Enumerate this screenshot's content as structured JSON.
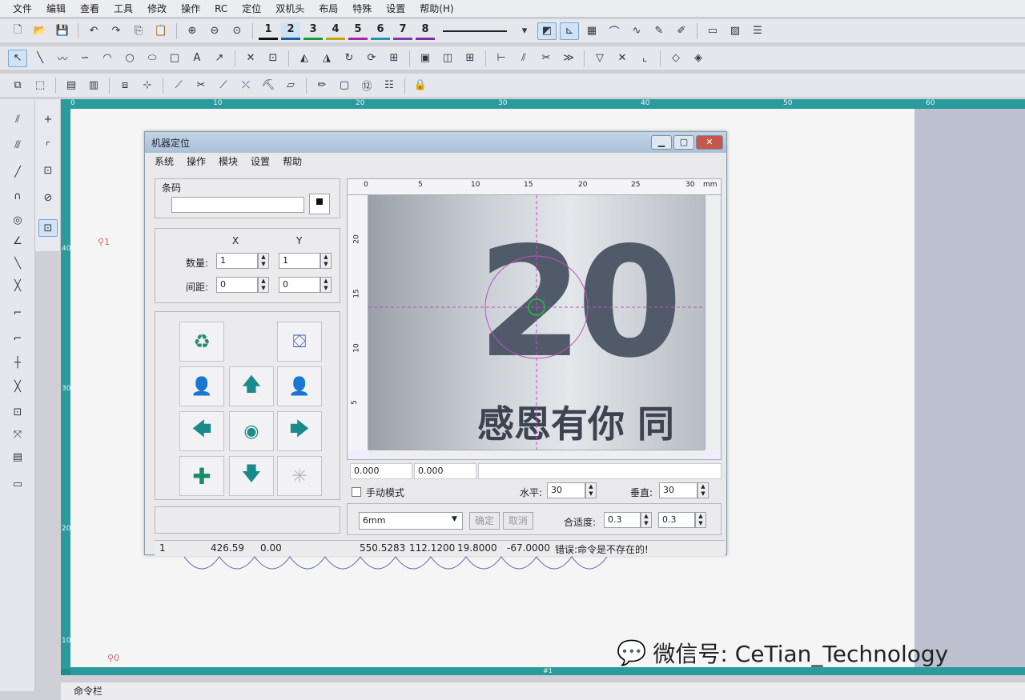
{
  "menu": [
    "文件",
    "编辑",
    "查看",
    "工具",
    "修改",
    "操作",
    "RC",
    "定位",
    "双机头",
    "布局",
    "特殊",
    "设置",
    "帮助(H)"
  ],
  "colors": {
    "c1": "#111111",
    "c2": "#1d5aa8",
    "c3": "#1b9a3a",
    "c4": "#b6a900",
    "c5": "#a224a8",
    "c6": "#1a9aa8",
    "c7": "#7a3aa8",
    "c8": "#7b2aa8"
  },
  "toolbar1": {
    "color_nums": [
      "1",
      "2",
      "3",
      "4",
      "5",
      "6",
      "7",
      "8"
    ]
  },
  "ruler": {
    "h_ticks": [
      "0",
      "10",
      "20",
      "30",
      "40",
      "50",
      "60"
    ],
    "v_ticks": [
      "40",
      "30",
      "20",
      "10"
    ]
  },
  "canvas": {
    "marker1": "1",
    "marker0": "0",
    "bottom_label": "#1"
  },
  "cmdbar": {
    "label": "命令栏"
  },
  "dialog": {
    "title": "机器定位",
    "title_buttons": [
      "▁",
      "▢",
      "✕"
    ],
    "menu": [
      "系统",
      "操作",
      "模块",
      "设置",
      "帮助"
    ],
    "barcode": {
      "label": "条码",
      "value": ""
    },
    "grid": {
      "col_x": "X",
      "col_y": "Y",
      "count_label": "数量:",
      "spacing_label": "间距:",
      "count_x": "1",
      "count_y": "1",
      "spacing_x": "0",
      "spacing_y": "0"
    },
    "camera": {
      "unit": "mm",
      "top_ticks": [
        "0",
        "5",
        "10",
        "15",
        "20",
        "25",
        "30"
      ],
      "left_ticks": [
        "20",
        "15",
        "10",
        "5"
      ],
      "big_text": "20",
      "slogan": "感恩有你 同",
      "coord_x": "0.000",
      "coord_y": "0.000"
    },
    "manual_mode": "手动模式",
    "horizontal": {
      "label": "水平:",
      "value": "30"
    },
    "vertical": {
      "label": "垂直:",
      "value": "30"
    },
    "size_select": "6mm",
    "confirm": "确定",
    "cancel": "取消",
    "fit": {
      "label": "合适度:",
      "value1": "0.3",
      "value2": "0.3"
    },
    "status": {
      "s1": "1",
      "s2": "426.59",
      "s3": "0.00",
      "s4": "550.5283",
      "s5": "112.1200",
      "s6": "19.8000",
      "s7": "-67.0000",
      "s8": "错误:命令是不存在的!"
    }
  },
  "watermark": {
    "text": "微信号: CeTian_Technology"
  }
}
